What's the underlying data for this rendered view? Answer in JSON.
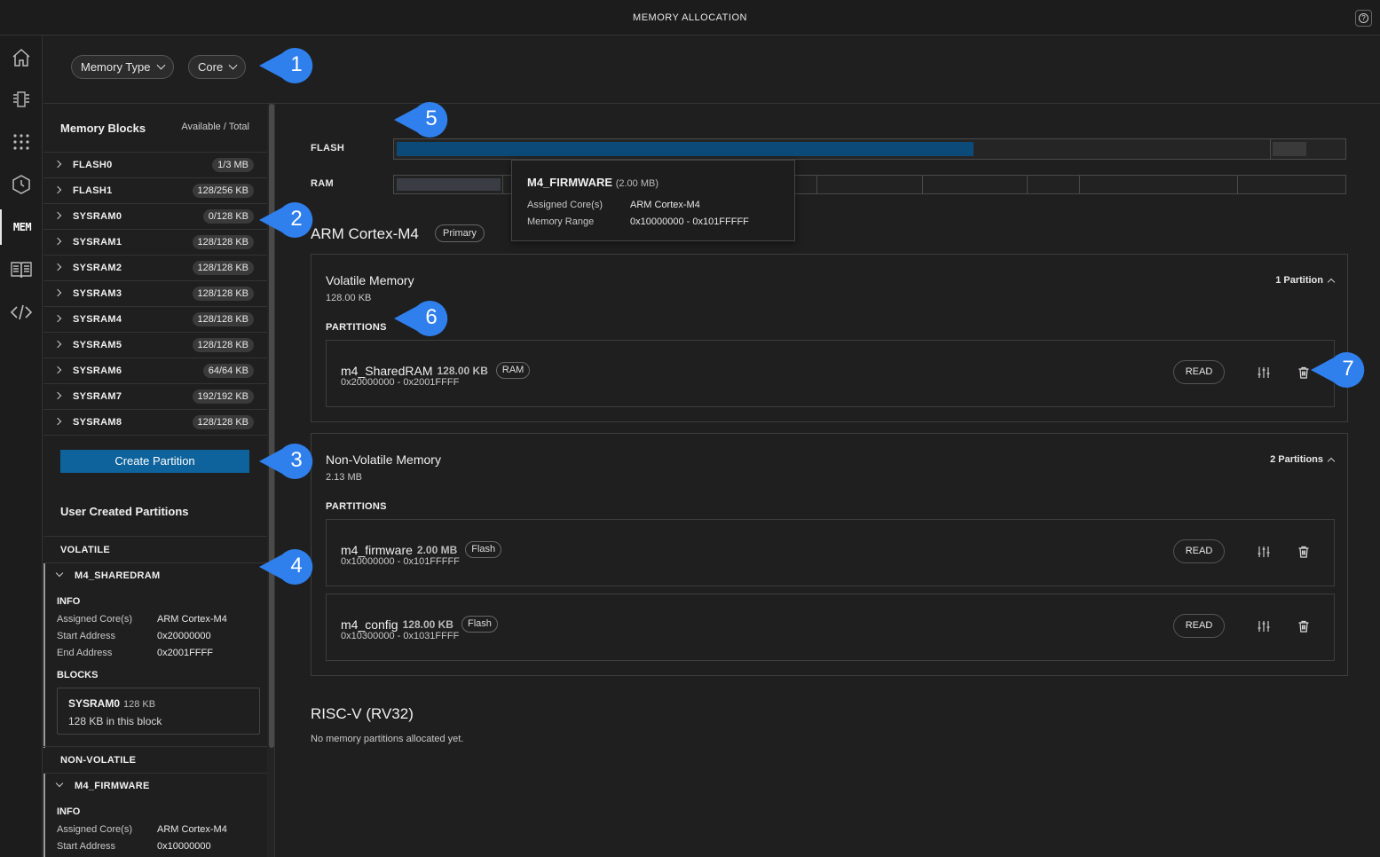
{
  "window": {
    "title": "MEMORY ALLOCATION"
  },
  "activity_bar": {
    "mem_label": "MEM"
  },
  "filters": {
    "memory_type": "Memory Type",
    "core": "Core"
  },
  "sidebar": {
    "header": "Memory Blocks",
    "header_right": "Available / Total",
    "blocks": [
      {
        "name": "FLASH0",
        "badge": "1/3 MB"
      },
      {
        "name": "FLASH1",
        "badge": "128/256 KB"
      },
      {
        "name": "SYSRAM0",
        "badge": "0/128 KB"
      },
      {
        "name": "SYSRAM1",
        "badge": "128/128 KB"
      },
      {
        "name": "SYSRAM2",
        "badge": "128/128 KB"
      },
      {
        "name": "SYSRAM3",
        "badge": "128/128 KB"
      },
      {
        "name": "SYSRAM4",
        "badge": "128/128 KB"
      },
      {
        "name": "SYSRAM5",
        "badge": "128/128 KB"
      },
      {
        "name": "SYSRAM6",
        "badge": "64/64 KB"
      },
      {
        "name": "SYSRAM7",
        "badge": "192/192 KB"
      },
      {
        "name": "SYSRAM8",
        "badge": "128/128 KB"
      }
    ],
    "create_button": "Create Partition",
    "user_partitions_title": "User Created Partitions",
    "volatile_label": "VOLATILE",
    "nonvolatile_label": "NON-VOLATILE",
    "sharedram": {
      "name": "M4_SHAREDRAM",
      "info_label": "INFO",
      "assigned_key": "Assigned Core(s)",
      "assigned_val": "ARM Cortex-M4",
      "start_key": "Start Address",
      "start_val": "0x20000000",
      "end_key": "End Address",
      "end_val": "0x2001FFFF",
      "blocks_label": "BLOCKS",
      "block_name": "SYSRAM0",
      "block_size": "128 KB",
      "block_desc": "128 KB in this block"
    },
    "firmware": {
      "name": "M4_FIRMWARE",
      "info_label": "INFO",
      "assigned_key": "Assigned Core(s)",
      "assigned_val": "ARM Cortex-M4",
      "start_key": "Start Address",
      "start_val": "0x10000000"
    }
  },
  "overview": {
    "flash_label": "FLASH",
    "ram_label": "RAM",
    "flash_used_fraction": 0.61
  },
  "tooltip": {
    "name": "M4_FIRMWARE",
    "size": "(2.00 MB)",
    "assigned_key": "Assigned Core(s)",
    "assigned_val": "ARM Cortex-M4",
    "range_key": "Memory Range",
    "range_val": "0x10000000 - 0x101FFFFF"
  },
  "arm_core": {
    "title": "ARM Cortex-M4",
    "badge": "Primary",
    "volatile": {
      "title": "Volatile Memory",
      "size": "128.00 KB",
      "count": "1 Partition",
      "partitions_label": "PARTITIONS",
      "partitions": [
        {
          "name": "m4_SharedRAM",
          "size": "128.00 KB",
          "tag": "RAM",
          "range": "0x20000000 - 0x2001FFFF",
          "action": "READ"
        }
      ]
    },
    "nonvolatile": {
      "title": "Non-Volatile Memory",
      "size": "2.13 MB",
      "count": "2 Partitions",
      "partitions_label": "PARTITIONS",
      "partitions": [
        {
          "name": "m4_firmware",
          "size": "2.00 MB",
          "tag": "Flash",
          "range": "0x10000000 - 0x101FFFFF",
          "action": "READ"
        },
        {
          "name": "m4_config",
          "size": "128.00 KB",
          "tag": "Flash",
          "range": "0x10300000 - 0x1031FFFF",
          "action": "READ"
        }
      ]
    }
  },
  "risc_core": {
    "title": "RISC-V (RV32)",
    "empty": "No memory partitions allocated yet."
  },
  "callouts": [
    "1",
    "2",
    "3",
    "4",
    "5",
    "6",
    "7"
  ],
  "colors": {
    "accent": "#0e639c",
    "callout": "#2f80ed",
    "flash_fill": "#0c4a7a"
  }
}
